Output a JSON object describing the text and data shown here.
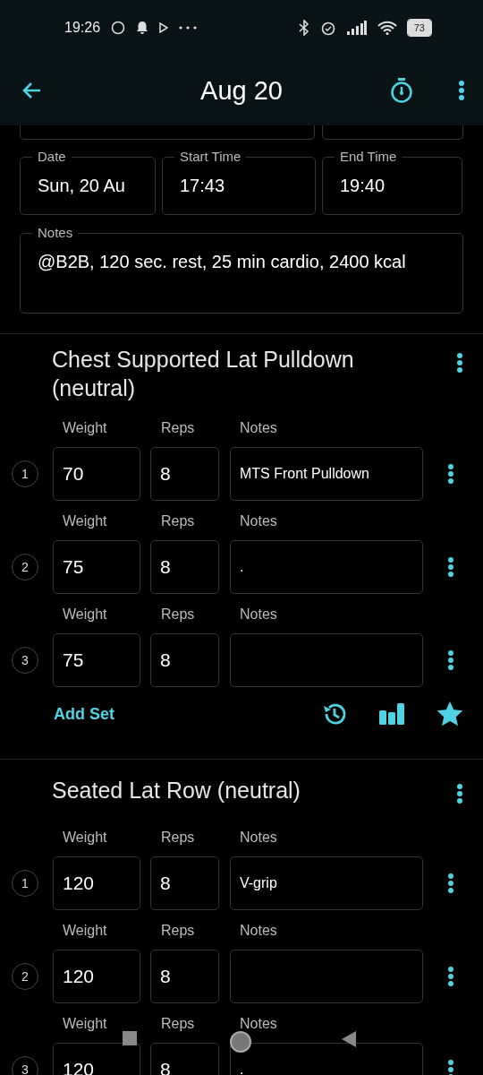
{
  "status_bar": {
    "time": "19:26",
    "battery": "73"
  },
  "app_bar": {
    "title": "Aug 20"
  },
  "session": {
    "fields": [
      {
        "label": "Date",
        "value": "Sun, 20 Au"
      },
      {
        "label": "Start Time",
        "value": "17:43"
      },
      {
        "label": "End Time",
        "value": "19:40"
      }
    ],
    "notes": {
      "label": "Notes",
      "value": "@B2B, 120 sec. rest, 25 min cardio, 2400 kcal"
    }
  },
  "exercises": [
    {
      "title": "Chest Supported Lat Pulldown (neutral)",
      "add_set": "Add Set",
      "sets": [
        {
          "number": "1",
          "weight_label": "Weight",
          "weight": "70",
          "reps_label": "Reps",
          "reps": "8",
          "notes_label": "Notes",
          "notes": "MTS Front Pulldown"
        },
        {
          "number": "2",
          "weight_label": "Weight",
          "weight": "75",
          "reps_label": "Reps",
          "reps": "8",
          "notes_label": "Notes",
          "notes": "."
        },
        {
          "number": "3",
          "weight_label": "Weight",
          "weight": "75",
          "reps_label": "Reps",
          "reps": "8",
          "notes_label": "Notes"
        }
      ]
    },
    {
      "title": "Seated Lat Row (neutral)",
      "sets": [
        {
          "number": "1",
          "weight_label": "Weight",
          "weight": "120",
          "reps_label": "Reps",
          "reps": "8",
          "notes_label": "Notes",
          "notes": "V-grip"
        },
        {
          "number": "2",
          "weight_label": "Weight",
          "weight": "120",
          "reps_label": "Reps",
          "reps": "8",
          "notes_label": "Notes"
        },
        {
          "number": "3",
          "weight_label": "Weight",
          "weight": "120",
          "reps_label": "Reps",
          "reps": "8",
          "notes_label": "Notes",
          "notes": "."
        }
      ]
    }
  ]
}
